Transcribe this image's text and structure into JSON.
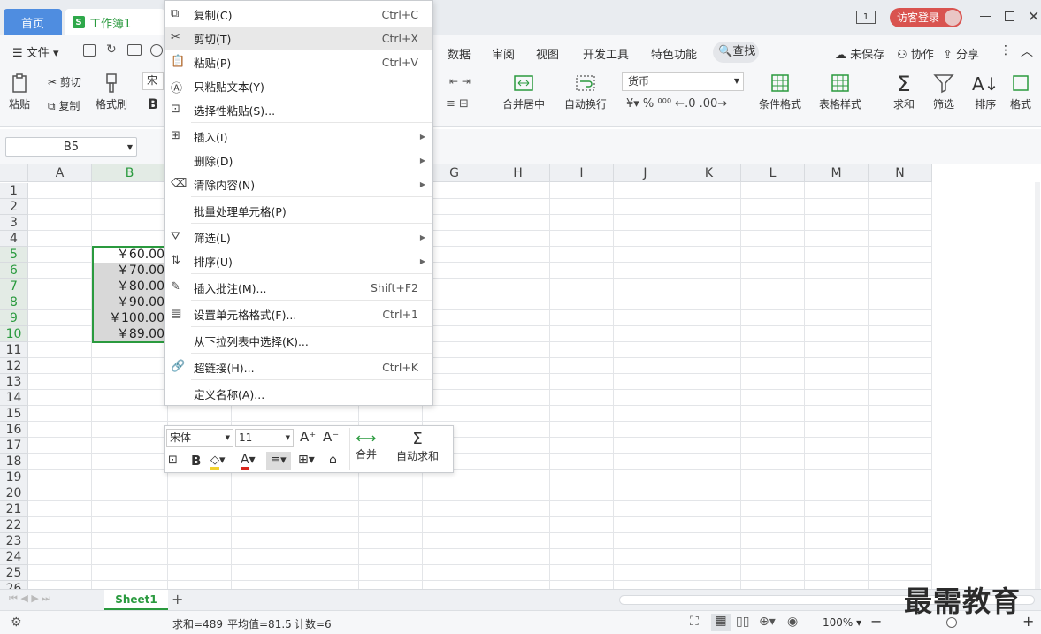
{
  "tabs": {
    "home": "首页",
    "book": "工作簿1"
  },
  "window": {
    "badge": "1",
    "login": "访客登录"
  },
  "menu": {
    "file": "文件",
    "data": "数据",
    "review": "审阅",
    "view": "视图",
    "dev": "开发工具",
    "special": "特色功能",
    "search": "查找",
    "unsaved": "未保存",
    "collab": "协作",
    "share": "分享"
  },
  "ribbon": {
    "paste": "粘贴",
    "cut": "剪切",
    "copy": "复制",
    "format_painter": "格式刷",
    "font_short": "宋体",
    "merge": "合并居中",
    "wrap": "自动换行",
    "number_format": "货币",
    "cond_format": "条件格式",
    "table_style": "表格样式",
    "sum": "求和",
    "filter": "筛选",
    "sort": "排序",
    "format": "格式"
  },
  "namebox": "B5",
  "columns": [
    "A",
    "B",
    "C",
    "D",
    "E",
    "F",
    "G",
    "H",
    "I",
    "J",
    "K",
    "L",
    "M",
    "N"
  ],
  "rows": [
    "1",
    "2",
    "3",
    "4",
    "5",
    "6",
    "7",
    "8",
    "9",
    "10",
    "11",
    "12",
    "13",
    "14",
    "15",
    "16",
    "17",
    "18",
    "19",
    "20",
    "21",
    "22",
    "23",
    "24",
    "25",
    "26"
  ],
  "cells": [
    "￥60.00",
    "￥70.00",
    "￥80.00",
    "￥90.00",
    "￥100.00",
    "￥89.00"
  ],
  "context_menu": [
    {
      "label": "复制(C)",
      "shortcut": "Ctrl+C"
    },
    {
      "label": "剪切(T)",
      "shortcut": "Ctrl+X"
    },
    {
      "label": "粘贴(P)",
      "shortcut": "Ctrl+V"
    },
    {
      "label": "只粘贴文本(Y)",
      "shortcut": ""
    },
    {
      "label": "选择性粘贴(S)...",
      "shortcut": ""
    },
    {
      "label": "插入(I)",
      "shortcut": ""
    },
    {
      "label": "删除(D)",
      "shortcut": ""
    },
    {
      "label": "清除内容(N)",
      "shortcut": ""
    },
    {
      "label": "批量处理单元格(P)",
      "shortcut": ""
    },
    {
      "label": "筛选(L)",
      "shortcut": ""
    },
    {
      "label": "排序(U)",
      "shortcut": ""
    },
    {
      "label": "插入批注(M)...",
      "shortcut": "Shift+F2"
    },
    {
      "label": "设置单元格格式(F)...",
      "shortcut": "Ctrl+1"
    },
    {
      "label": "从下拉列表中选择(K)...",
      "shortcut": ""
    },
    {
      "label": "超链接(H)...",
      "shortcut": "Ctrl+K"
    },
    {
      "label": "定义名称(A)...",
      "shortcut": ""
    }
  ],
  "mini_toolbar": {
    "font": "宋体",
    "size": "11",
    "merge": "合并",
    "autosum": "自动求和"
  },
  "sheet": {
    "name": "Sheet1"
  },
  "status": {
    "sum": "求和=489",
    "avg": "平均值=81.5",
    "count": "计数=6",
    "zoom": "100%"
  },
  "watermark": "最需教育",
  "colors": {
    "accent": "#4f8de0",
    "green": "#2a9a3e",
    "login": "#d9534f"
  }
}
